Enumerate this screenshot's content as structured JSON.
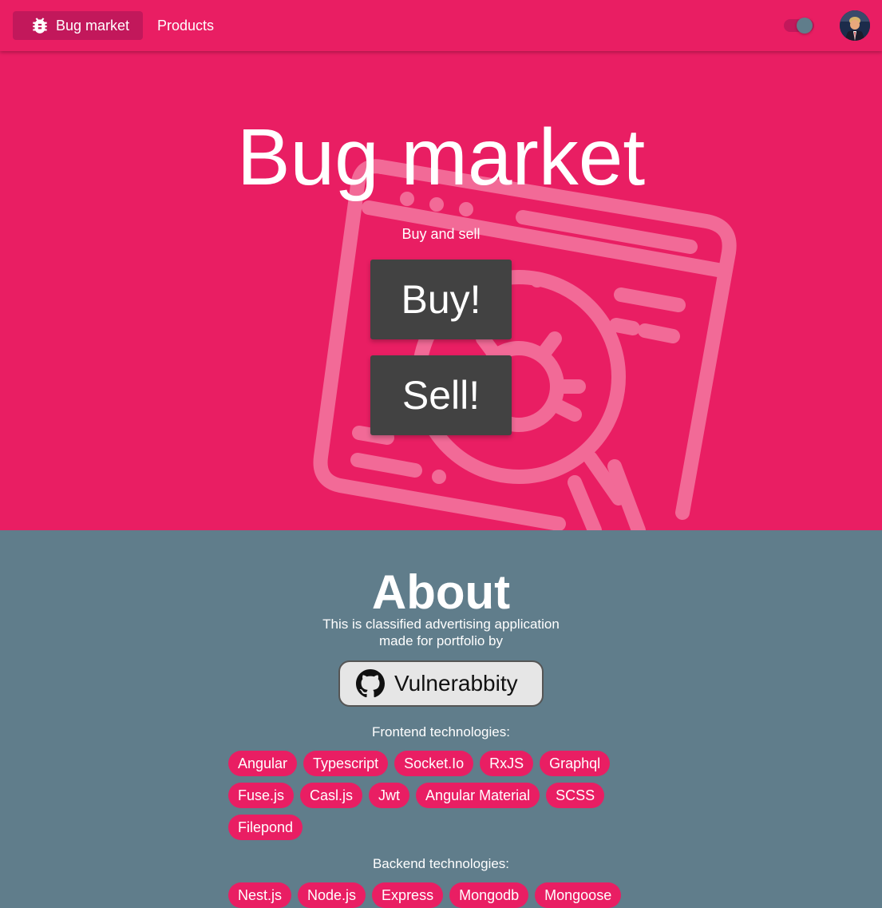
{
  "colors": {
    "primary": "#e91e63",
    "primary_dark": "#c2185b",
    "accent": "#607d8b",
    "button": "#424242"
  },
  "toolbar": {
    "brand_label": "Bug market",
    "brand_icon": "bug-icon",
    "nav_products": "Products",
    "theme_toggle_icon": "moon-icon",
    "dark_mode_on": true
  },
  "hero": {
    "title": "Bug market",
    "subtitle": "Buy and sell",
    "buy_label": "Buy!",
    "sell_label": "Sell!"
  },
  "about": {
    "title": "About",
    "text_line1": "This is classified advertising application",
    "text_line2": "made for portfolio by",
    "github_label": "Vulnerabbity",
    "frontend_label": "Frontend technologies:",
    "frontend": {
      "row1": [
        "Angular",
        "Typescript",
        "Socket.Io",
        "RxJS",
        "Graphql"
      ],
      "row2": [
        "Fuse.js",
        "Casl.js",
        "Jwt",
        "Angular Material",
        "SCSS"
      ],
      "row3": [
        "Filepond"
      ]
    },
    "backend_label": "Backend technologies:",
    "backend": {
      "row1": [
        "Nest.js",
        "Node.js",
        "Express",
        "Mongodb",
        "Mongoose"
      ]
    }
  }
}
